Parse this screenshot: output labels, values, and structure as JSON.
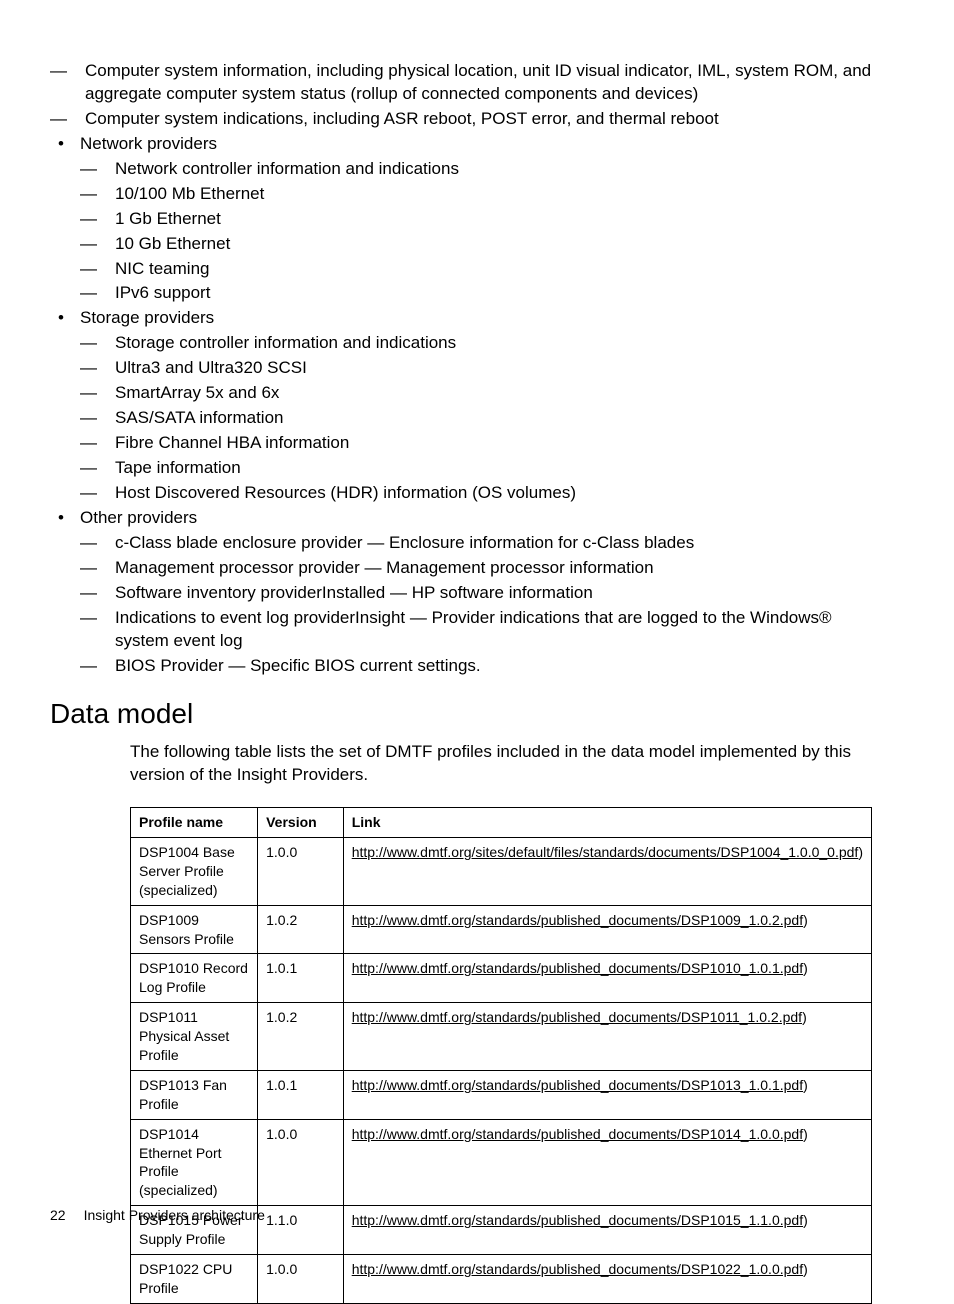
{
  "top_dash": [
    "Computer system information, including physical location, unit ID visual indicator, IML, system ROM, and aggregate computer system status (rollup of connected components and devices)",
    "Computer system indications, including ASR reboot, POST error, and thermal reboot"
  ],
  "bullets": [
    {
      "label": "Network providers",
      "items": [
        "Network controller information and indications",
        "10/100 Mb Ethernet",
        "1 Gb Ethernet",
        "10 Gb Ethernet",
        "NIC teaming",
        "IPv6 support"
      ]
    },
    {
      "label": "Storage providers",
      "items": [
        "Storage controller information and indications",
        "Ultra3 and Ultra320 SCSI",
        "SmartArray 5x and 6x",
        "SAS/SATA information",
        "Fibre Channel HBA information",
        "Tape information",
        "Host Discovered Resources (HDR) information (OS volumes)"
      ]
    },
    {
      "label": "Other providers",
      "items": [
        "c-Class blade enclosure provider — Enclosure information for c-Class blades",
        "Management processor provider — Management processor information",
        "Software inventory providerInstalled — HP software information",
        "Indications to event log providerInsight — Provider indications that are logged to the Windows® system event log",
        "BIOS Provider — Specific BIOS current settings."
      ]
    }
  ],
  "section_heading": "Data model",
  "intro_text": "The following table lists the set of DMTF profiles included in the data model implemented by this version of the Insight Providers.",
  "table": {
    "headers": [
      "Profile name",
      "Version",
      "Link"
    ],
    "rows": [
      {
        "name": "DSP1004 Base Server Profile (specialized)",
        "version": "1.0.0",
        "link_text": "http://www.dmtf.org/sites/default/files/standards/documents/DSP1004_1.0.0_0.pdf",
        "trailing": ")"
      },
      {
        "name": "DSP1009 Sensors Profile",
        "version": "1.0.2",
        "link_text": "http://www.dmtf.org/standards/published_documents/DSP1009_1.0.2.pdf",
        "trailing": ")"
      },
      {
        "name": "DSP1010 Record Log Profile",
        "version": "1.0.1",
        "link_text": "http://www.dmtf.org/standards/published_documents/DSP1010_1.0.1.pdf",
        "trailing": ")"
      },
      {
        "name": "DSP1011 Physical Asset Profile",
        "version": "1.0.2",
        "link_text": "http://www.dmtf.org/standards/published_documents/DSP1011_1.0.2.pdf",
        "trailing": ")"
      },
      {
        "name": "DSP1013 Fan Profile",
        "version": "1.0.1",
        "link_text": "http://www.dmtf.org/standards/published_documents/DSP1013_1.0.1.pdf",
        "trailing": ")"
      },
      {
        "name": "DSP1014 Ethernet Port Profile (specialized)",
        "version": "1.0.0",
        "link_text": "http://www.dmtf.org/standards/published_documents/DSP1014_1.0.0.pdf",
        "trailing": ")"
      },
      {
        "name": "DSP1015 Power Supply Profile",
        "version": "1.1.0",
        "link_text": "http://www.dmtf.org/standards/published_documents/DSP1015_1.1.0.pdf",
        "trailing": ")"
      },
      {
        "name": "DSP1022 CPU Profile",
        "version": "1.0.0",
        "link_text": "http://www.dmtf.org/standards/published_documents/DSP1022_1.0.0.pdf",
        "trailing": ")"
      }
    ]
  },
  "footer": {
    "page_number": "22",
    "section": "Insight Providers architecture"
  }
}
